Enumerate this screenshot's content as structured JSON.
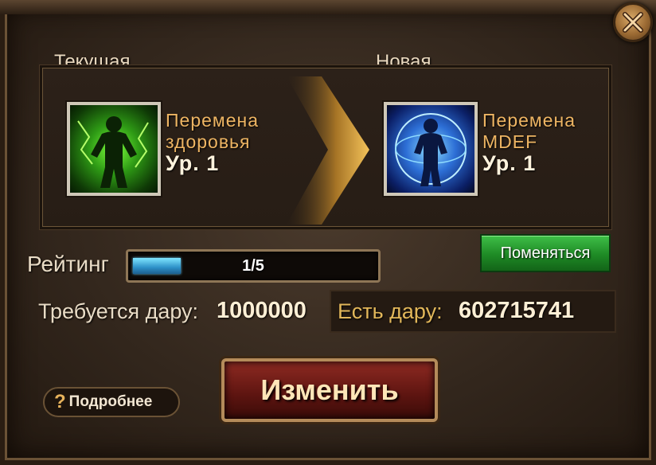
{
  "dialog": {
    "current_label": "Текущая",
    "new_label": "Новая",
    "close_icon": "close-icon"
  },
  "current_skill": {
    "name_line1": "Перемена",
    "name_line2": "здоровья",
    "level": "Ур. 1",
    "icon": "skill-health-icon"
  },
  "new_skill": {
    "name_line1": "Перемена",
    "name_line2": "MDEF",
    "level": "Ур. 1",
    "icon": "skill-mdef-icon"
  },
  "rating": {
    "label": "Рейтинг",
    "value_text": "1/5",
    "progress": 0.2
  },
  "swap_button": "Поменяться",
  "cost": {
    "required_label": "Требуется дару:",
    "required_value": "1000000",
    "have_label": "Есть дару:",
    "have_value": "602715741"
  },
  "help_button": {
    "icon": "?",
    "label": "Подробнее"
  },
  "change_button": "Изменить",
  "colors": {
    "accent_gold": "#e2b75a",
    "swap_green": "#1e8a25",
    "change_red": "#5c1410",
    "bar_blue": "#2d90c8"
  }
}
